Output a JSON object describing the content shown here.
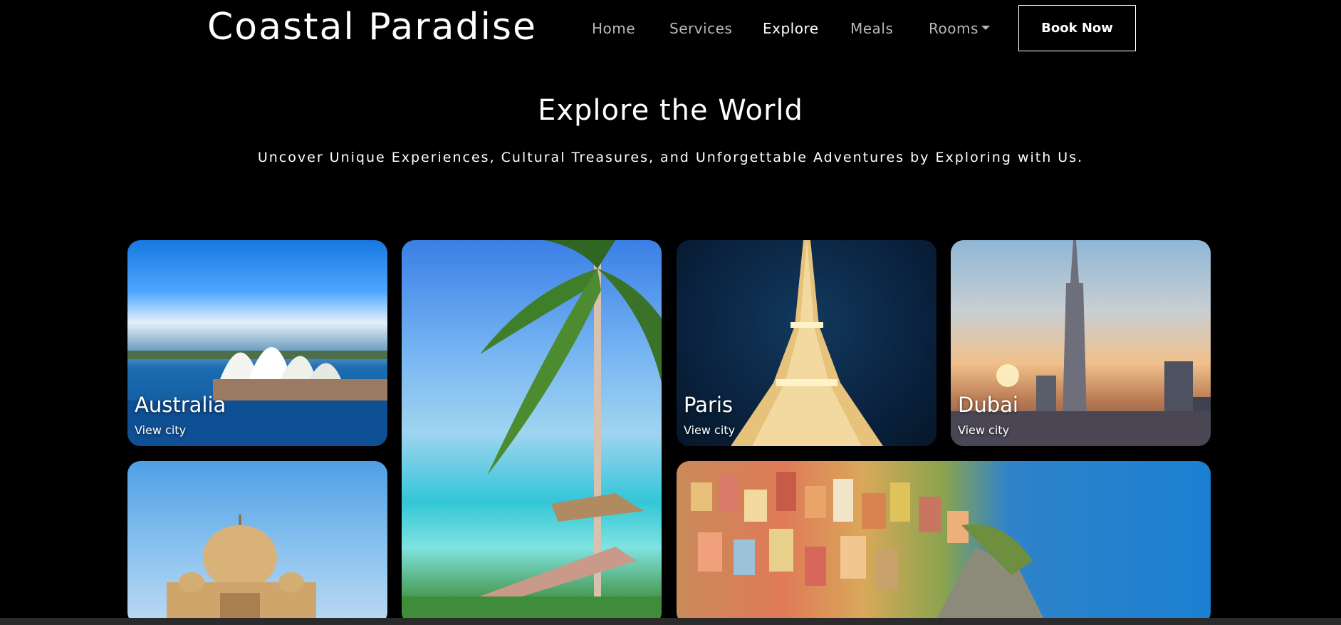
{
  "brand": "Coastal Paradise",
  "nav": {
    "items": [
      {
        "label": "Home"
      },
      {
        "label": "Services"
      },
      {
        "label": "Explore"
      },
      {
        "label": "Meals"
      },
      {
        "label": "Rooms"
      }
    ],
    "active": "Explore",
    "book_label": "Book Now"
  },
  "hero": {
    "title": "Explore the World",
    "subtitle": "Uncover Unique Experiences, Cultural Treasures, and Unforgettable Adventures by Exploring with Us."
  },
  "cards": [
    {
      "title": "Australia",
      "link": "View city"
    },
    {
      "title": "Paris",
      "link": "View city"
    },
    {
      "title": "Dubai",
      "link": "View city"
    }
  ],
  "colors": {
    "background": "#000000",
    "text": "#ffffff",
    "nav_inactive": "#b8b8b8"
  }
}
